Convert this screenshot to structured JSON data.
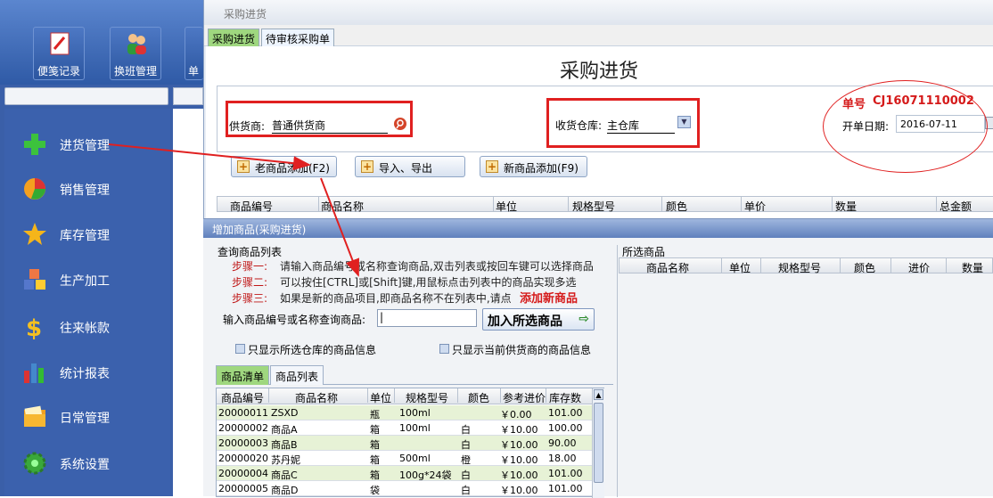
{
  "toolbar": {
    "b1": "便笺记录",
    "b2": "换班管理",
    "b3": "单"
  },
  "menu": [
    "进货管理",
    "销售管理",
    "库存管理",
    "生产加工",
    "往来帐款",
    "统计报表",
    "日常管理",
    "系统设置"
  ],
  "window": {
    "title": "采购进货",
    "tab_active": "采购进货",
    "tab_other": "待审核采购单",
    "form_title": "采购进货"
  },
  "form": {
    "supplier_label": "供货商:",
    "supplier_value": "普通供货商",
    "warehouse_label": "收货仓库:",
    "warehouse_value": "主仓库",
    "order_no_label": "单号",
    "order_no": "CJ16071110002",
    "date_label": "开单日期:",
    "date_value": "2016-07-11"
  },
  "buttons": {
    "old_add": "老商品添加(F2)",
    "import_export": "导入、导出",
    "new_add": "新商品添加(F9)"
  },
  "grid_headers": [
    "商品编号",
    "商品名称",
    "单位",
    "规格型号",
    "颜色",
    "单价",
    "数量",
    "总金额"
  ],
  "popup": {
    "title": "增加商品(采购进货)",
    "query_group": "查询商品列表",
    "step1_k": "步骤一:",
    "step1_t": "请输入商品编号或名称查询商品,双击列表或按回车键可以选择商品",
    "step2_k": "步骤二:",
    "step2_t": "可以按住[CTRL]或[Shift]键,用鼠标点击列表中的商品实现多选",
    "step3_k": "步骤三:",
    "step3_t": "如果是新的商品项目,即商品名称不在列表中,请点",
    "add_new": "添加新商品",
    "search_label": "输入商品编号或名称查询商品:",
    "search_value": "|",
    "add_selected": "加入所选商品",
    "chk1": "只显示所选仓库的商品信息",
    "chk2": "只显示当前供货商的商品信息",
    "subtab1": "商品清单",
    "subtab2": "商品列表",
    "selected_title": "所选商品",
    "selected_headers": [
      "商品名称",
      "单位",
      "规格型号",
      "颜色",
      "进价",
      "数量"
    ]
  },
  "product_list": {
    "headers": [
      "商品编号",
      "商品名称",
      "单位",
      "规格型号",
      "颜色",
      "参考进价",
      "库存数"
    ],
    "rows": [
      [
        "20000011",
        "ZSXD",
        "瓶",
        "100ml",
        "",
        "￥0.00",
        "101.00"
      ],
      [
        "20000002",
        "商品A",
        "箱",
        "100ml",
        "白",
        "￥10.00",
        "100.00"
      ],
      [
        "20000003",
        "商品B",
        "箱",
        "",
        "白",
        "￥10.00",
        "90.00"
      ],
      [
        "20000020",
        "苏丹妮",
        "箱",
        "500ml",
        "橙",
        "￥10.00",
        "18.00"
      ],
      [
        "20000004",
        "商品C",
        "箱",
        "100g*24袋",
        "白",
        "￥10.00",
        "101.00"
      ],
      [
        "20000005",
        "商品D",
        "袋",
        "",
        "白",
        "￥10.00",
        "101.00"
      ]
    ]
  },
  "colors": {
    "accent_green": "#9fd77f",
    "annotation_red": "#e02020",
    "menu_blue": "#3b61ad"
  }
}
